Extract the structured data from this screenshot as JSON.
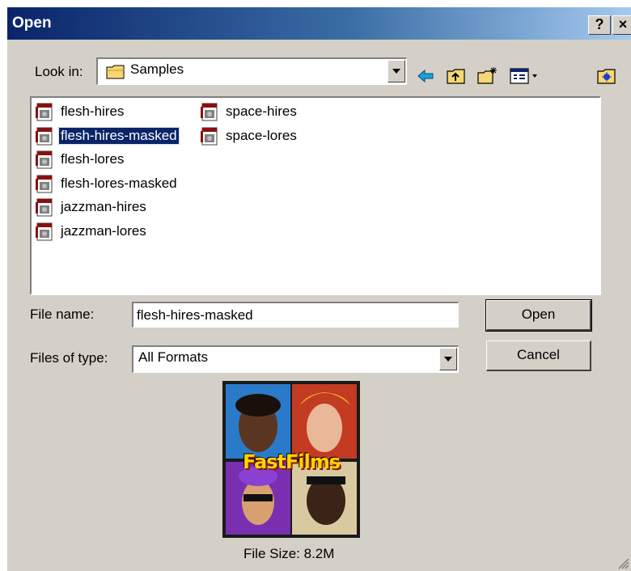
{
  "window": {
    "title": "Open",
    "help_label": "?",
    "close_label": "×"
  },
  "look_in": {
    "label": "Look in:",
    "value": "Samples"
  },
  "files": [
    {
      "name": "flesh-hires",
      "selected": false
    },
    {
      "name": "flesh-hires-masked",
      "selected": true
    },
    {
      "name": "flesh-lores",
      "selected": false
    },
    {
      "name": "flesh-lores-masked",
      "selected": false
    },
    {
      "name": "jazzman-hires",
      "selected": false
    },
    {
      "name": "jazzman-lores",
      "selected": false
    },
    {
      "name": "space-hires",
      "selected": false
    },
    {
      "name": "space-lores",
      "selected": false
    }
  ],
  "file_name": {
    "label": "File name:",
    "value": "flesh-hires-masked"
  },
  "file_type": {
    "label": "Files of type:",
    "value": "All Formats"
  },
  "buttons": {
    "open": "Open",
    "cancel": "Cancel"
  },
  "preview": {
    "logo_text": "FastFilms",
    "file_size": "File Size:  8.2M"
  },
  "colors": {
    "titlebar": "#0a246a",
    "selection": "#0a246a",
    "face": "#d4d0c8"
  },
  "icons": [
    "folder-icon",
    "back-arrow-icon",
    "up-folder-icon",
    "new-folder-icon",
    "view-menu-icon",
    "desktop-folder-icon",
    "image-file-icon"
  ]
}
